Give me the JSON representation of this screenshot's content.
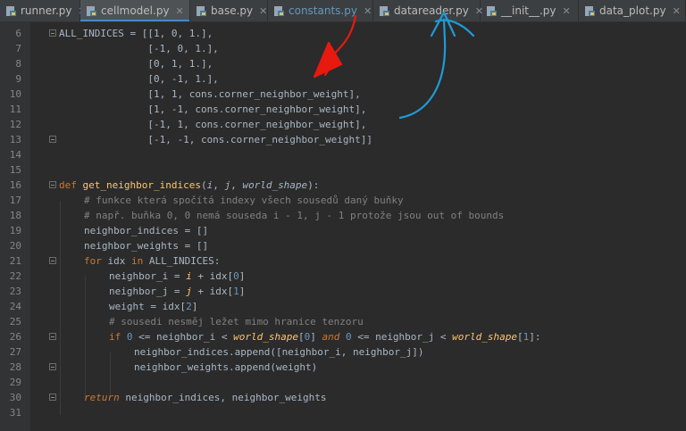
{
  "tabs": [
    {
      "label": "runner.py",
      "active": false
    },
    {
      "label": "cellmodel.py",
      "active": true
    },
    {
      "label": "base.py",
      "active": false
    },
    {
      "label": "constants.py",
      "active": false
    },
    {
      "label": "datareader.py",
      "active": false
    },
    {
      "label": "__init__.py",
      "active": false
    },
    {
      "label": "data_plot.py",
      "active": false
    }
  ],
  "line_numbers": [
    "6",
    "7",
    "8",
    "9",
    "10",
    "11",
    "12",
    "13",
    "14",
    "15",
    "16",
    "17",
    "18",
    "19",
    "20",
    "21",
    "22",
    "23",
    "24",
    "25",
    "26",
    "27",
    "28",
    "29",
    "30",
    "31"
  ],
  "code": {
    "l6": "ALL_INDICES = [[1, 0, 1.],",
    "l7": "               [-1, 0, 1.],",
    "l8": "               [0, 1, 1.],",
    "l9": "               [0, -1, 1.],",
    "l10": "               [1, 1, cons.corner_neighbor_weight],",
    "l11": "               [1, -1, cons.corner_neighbor_weight],",
    "l12": "               [-1, 1, cons.corner_neighbor_weight],",
    "l13": "               [-1, -1, cons.corner_neighbor_weight]]",
    "fn_def": "def",
    "fn_name": "get_neighbor_indices",
    "p_i": "i",
    "p_j": "j",
    "p_ws": "world_shape",
    "c17": "# funkce která spočítá indexy všech sousedů daný buňky",
    "c18": "# např. buňka 0, 0 nemá souseda i - 1, j - 1 protože jsou out of bounds",
    "l19": "neighbor_indices = []",
    "l20": "neighbor_weights = []",
    "kw_for": "for",
    "l21_var": "idx",
    "kw_in": "in",
    "l21_tail": "ALL_INDICES:",
    "l22_a": "neighbor_i = ",
    "l22_b": "i",
    "l22_c": " + idx[",
    "l22_n": "0",
    "l22_d": "]",
    "l23_a": "neighbor_j = ",
    "l23_b": "j",
    "l23_c": " + idx[",
    "l23_n": "1",
    "l23_d": "]",
    "l24_a": "weight = idx[",
    "l24_n": "2",
    "l24_d": "]",
    "c25": "# sousedi nesměj ležet mimo hranice tenzoru",
    "kw_if": "if",
    "l26_n0": "0",
    "l26_a": " <= neighbor_i < ",
    "l26_ws": "world_shape",
    "l26_b": "[",
    "l26_i0": "0",
    "l26_c": "] ",
    "kw_and": "and",
    "l26_n02": "0",
    "l26_d": " <= neighbor_j < ",
    "l26_ws2": "world_shape",
    "l26_e": "[",
    "l26_i1": "1",
    "l26_f": "]:",
    "l27": "neighbor_indices.append([neighbor_i, neighbor_j])",
    "l28": "neighbor_weights.append(weight)",
    "kw_return": "return",
    "l30_tail": " neighbor_indices, neighbor_weights"
  },
  "colors": {
    "keyword": "#cc7832",
    "function": "#ffc66d",
    "number": "#6897bb",
    "comment": "#808080",
    "text": "#a9b7c6",
    "red_annotation": "#e8190f",
    "blue_annotation": "#1e9bd7"
  }
}
